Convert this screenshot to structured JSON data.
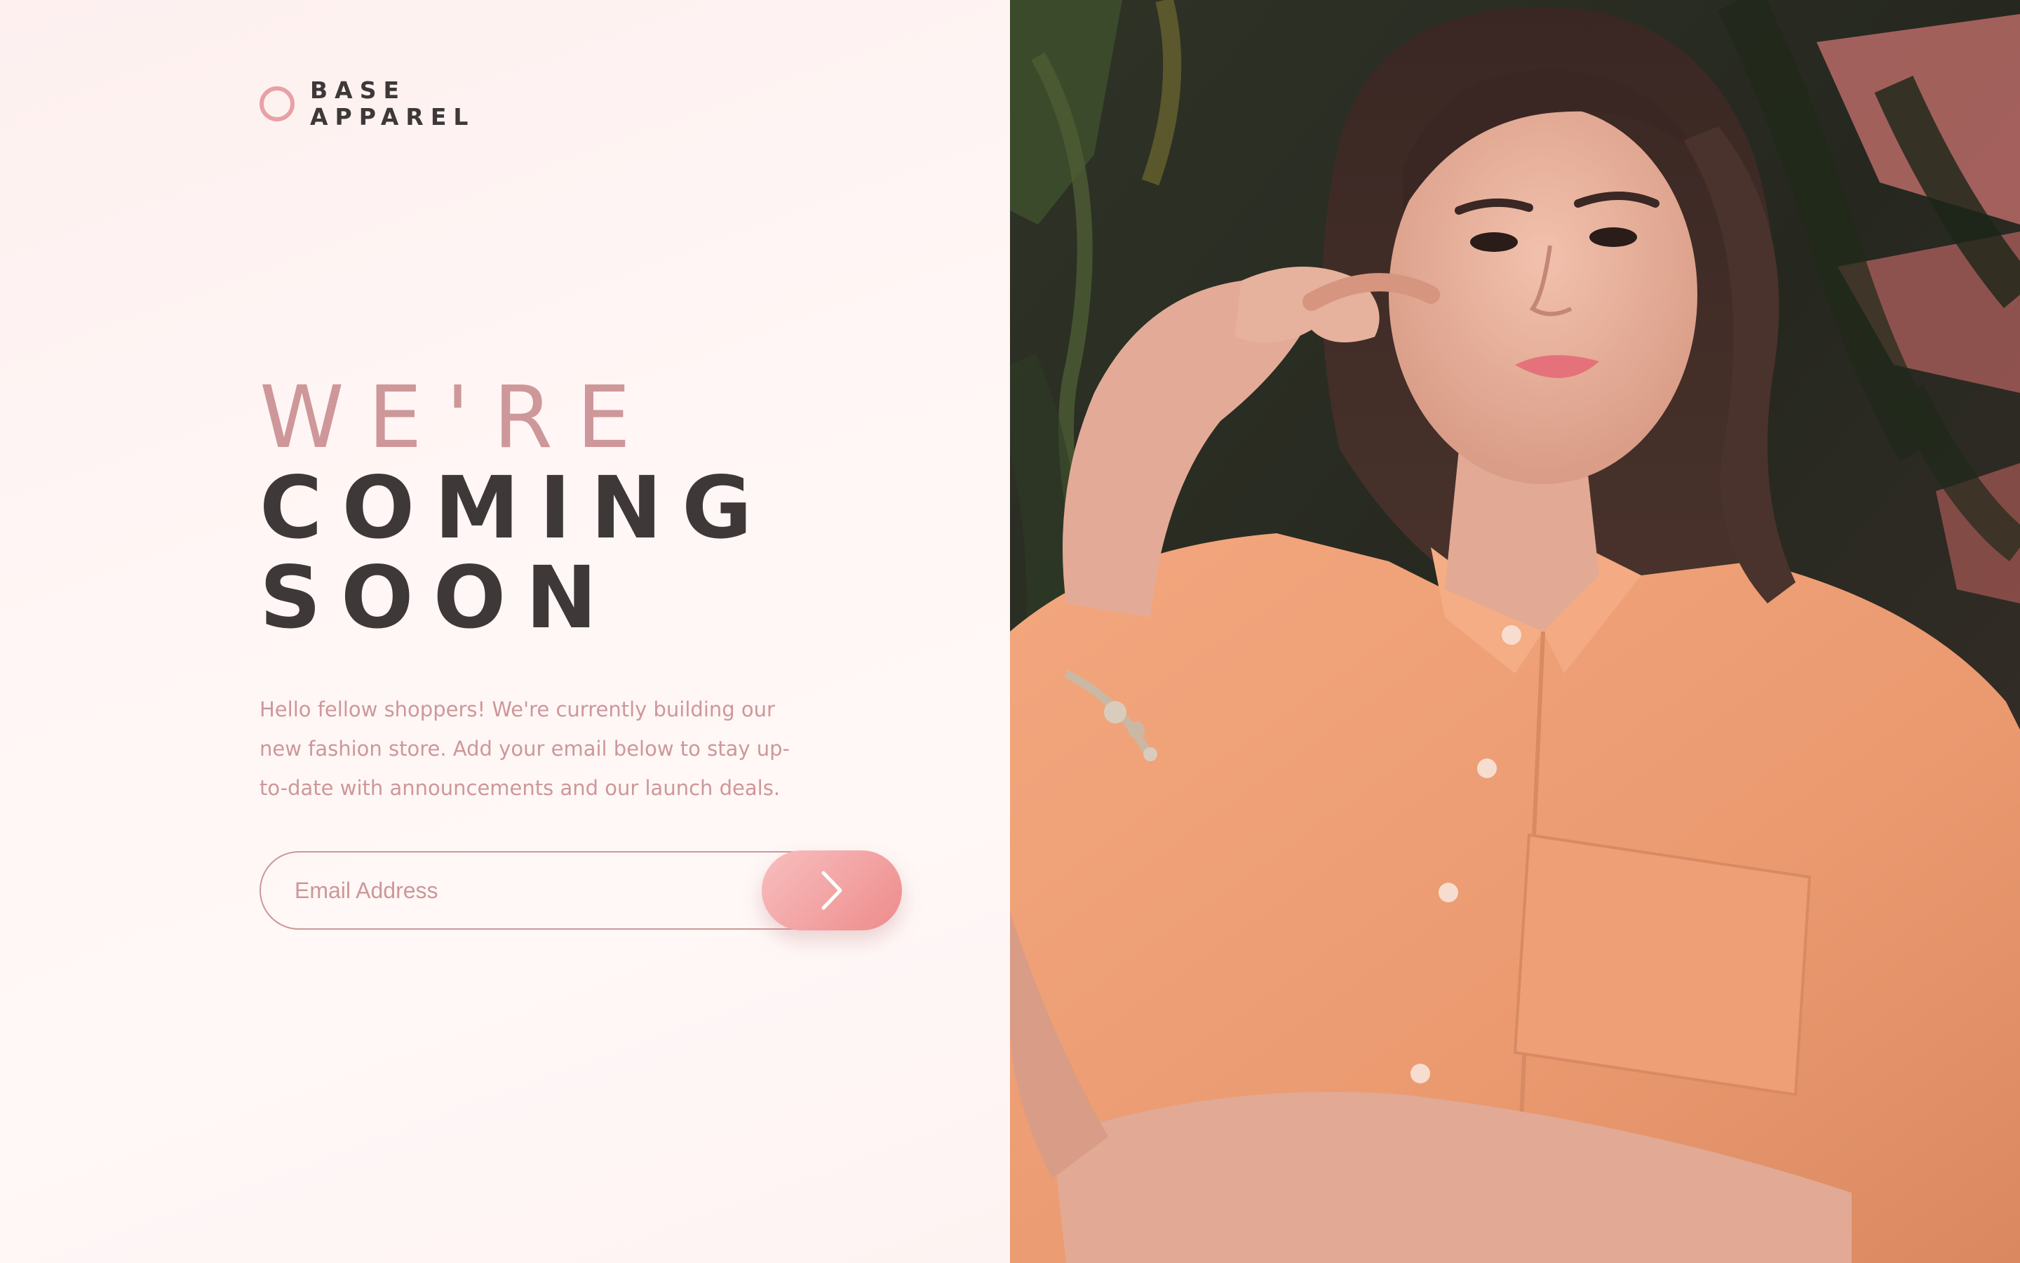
{
  "brand": {
    "line1": "BASE",
    "line2": "APPAREL"
  },
  "hero": {
    "line1": "WE'RE",
    "line2": "COMING",
    "line3": "SOON",
    "description": "Hello fellow shoppers! We're currently building our new fashion store. Add your email below to stay up-to-date with announcements and our launch deals."
  },
  "signup": {
    "placeholder": "Email Address",
    "value": "",
    "submit_icon": "chevron-right-icon"
  },
  "image": {
    "subject": "woman in peach shirt"
  },
  "colors": {
    "accent": "#ce9799",
    "dark_text": "#3e3838",
    "button_start": "#f8bfbf",
    "button_end": "#ee8b8b",
    "background": "#fdf3f2"
  }
}
